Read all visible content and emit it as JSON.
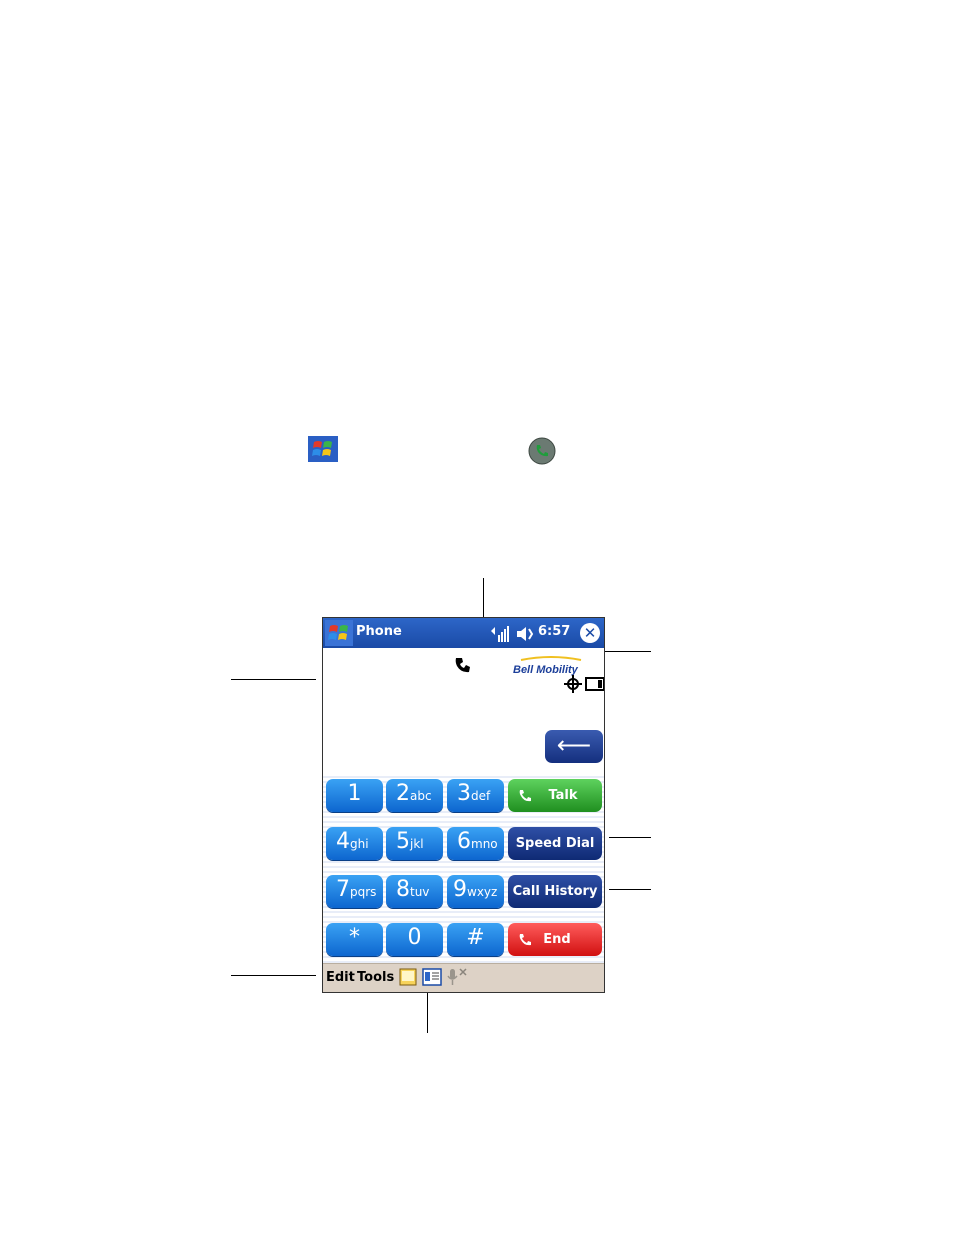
{
  "window": {
    "title": "Phone",
    "time": "6:57",
    "close_glyph": "✕"
  },
  "status": {
    "carrier": "Bell Mobility"
  },
  "backspace_glyph": "⟵",
  "keypad": {
    "keys": [
      {
        "digit": "1",
        "letters": ""
      },
      {
        "digit": "2",
        "letters": "abc"
      },
      {
        "digit": "3",
        "letters": "def"
      },
      {
        "digit": "4",
        "letters": "ghi"
      },
      {
        "digit": "5",
        "letters": "jkl"
      },
      {
        "digit": "6",
        "letters": "mno"
      },
      {
        "digit": "7",
        "letters": "pqrs"
      },
      {
        "digit": "8",
        "letters": "tuv"
      },
      {
        "digit": "9",
        "letters": "wxyz"
      },
      {
        "digit": "*",
        "letters": ""
      },
      {
        "digit": "0",
        "letters": ""
      },
      {
        "digit": "#",
        "letters": ""
      }
    ],
    "talk_label": "Talk",
    "speed_dial_label": "Speed Dial",
    "call_history_label": "Call History",
    "end_label": "End"
  },
  "menu": {
    "edit": "Edit",
    "tools": "Tools"
  },
  "icons": {
    "start": "windows-start-icon",
    "phone": "phone-handset-icon",
    "signal": "signal-strength-icon",
    "speaker": "speaker-muted-icon",
    "roaming": "roaming-icon",
    "gps": "crosshair-icon",
    "battery": "battery-icon",
    "notes": "notes-icon",
    "input": "input-panel-icon",
    "microphone": "microphone-off-icon"
  },
  "colors": {
    "titlebar": "#1a4aa6",
    "digit_key": "#1a7fe0",
    "talk": "#2fa82f",
    "navy_button": "#142f7e",
    "end": "#e01818",
    "menubar": "#ddd2c6"
  }
}
